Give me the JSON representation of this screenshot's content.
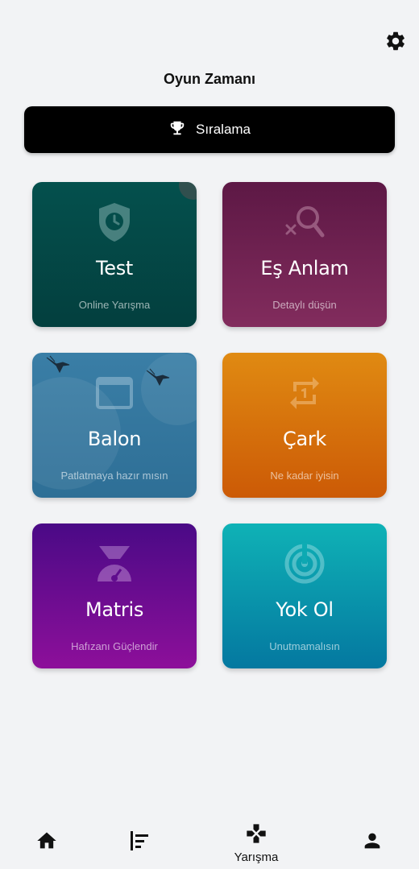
{
  "header": {
    "title": "Oyun Zamanı",
    "settings_icon": "gear-icon"
  },
  "ranking_button": {
    "label": "Sıralama",
    "icon": "trophy-icon"
  },
  "games": [
    {
      "title": "Test",
      "subtitle": "Online Yarışma",
      "icon": "shield-clock-icon",
      "color": "#04504d"
    },
    {
      "title": "Eş Anlam",
      "subtitle": "Detaylı düşün",
      "icon": "search-x-icon",
      "color": "#6e2050"
    },
    {
      "title": "Balon",
      "subtitle": "Patlatmaya hazır mısın",
      "icon": "window-icon",
      "color": "#3479a1"
    },
    {
      "title": "Çark",
      "subtitle": "Ne kadar iyisin",
      "icon": "repeat-one-icon",
      "color": "#d9740c"
    },
    {
      "title": "Matris",
      "subtitle": "Hafızanı Güçlendir",
      "icon": "scale-icon",
      "color": "#6a0c90"
    },
    {
      "title": "Yok Ol",
      "subtitle": "Unutmamalısın",
      "icon": "radar-icon",
      "color": "#0a95ac"
    }
  ],
  "bottom_nav": {
    "items": [
      {
        "icon": "home-icon",
        "label": ""
      },
      {
        "icon": "align-left-icon",
        "label": ""
      },
      {
        "icon": "gamepad-icon",
        "label": "Yarışma"
      },
      {
        "icon": "person-icon",
        "label": ""
      }
    ]
  }
}
